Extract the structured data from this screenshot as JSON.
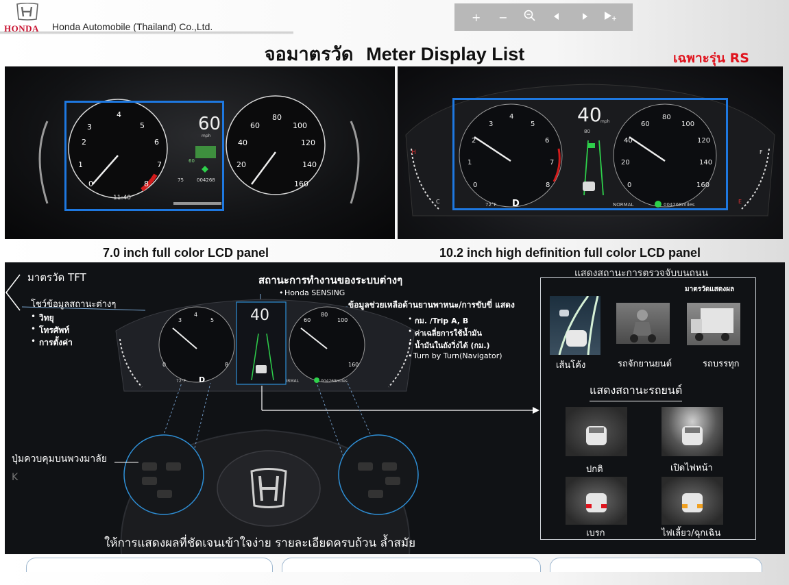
{
  "header": {
    "brand_word": "HONDA",
    "company": "Honda Automobile (Thailand) Co.,Ltd.",
    "title_th": "จอมาตรวัด",
    "title_en": "Meter Display List",
    "rs_label": "เฉพาะรุ่น RS"
  },
  "toolbar": {
    "zoom_in": "+",
    "zoom_out": "−",
    "zoom_magnifier": "⊖",
    "prev": "◆",
    "next": "◆",
    "pointer": "➤"
  },
  "panels": {
    "left_caption": "7.0 inch full color LCD panel",
    "right_caption": "10.2 inch high definition full color LCD panel",
    "left_speed": "60",
    "left_speed_unit": "mph",
    "left_clock": "11:40",
    "left_odo": "004268",
    "left_temp": "75",
    "left_cruise": "60",
    "right_speed": "40",
    "right_speed_unit": "mph",
    "right_cruise": "80",
    "right_gear": "D",
    "right_temp": "72°F",
    "right_mode": "NORMAL",
    "right_odo": "004268miles"
  },
  "lower": {
    "tft_label": "มาตรวัด TFT",
    "info_label": "โชว์ข้อมูลสถานะต่างๆ",
    "info_items": [
      "วิทยุ",
      "โทรศัพท์",
      "การตั้งค่า"
    ],
    "status_title": "สถานะการทำงานของระบบต่างๆ",
    "sensing_item": "Honda SENSING",
    "assist_title": "ข้อมูลช่วยเหลือด้านยานพาหนะ/การขับขี่ แสดง",
    "assist_items": [
      "กม. /Trip A, B",
      "ค่าเฉลี่ยการใช้น้ำมัน",
      "น้ำมันในถังวิ่งได้ (กม.)",
      "Turn by Turn(Navigator)"
    ],
    "wheel_label": "ปุ่มควบคุมบนพวงมาลัย",
    "bottom_slogan": "ให้การแสดงผลที่ชัดเจนเข้าใจง่าย รายละเอียดครบถ้วน ล้ำสมัย",
    "meter_speed": "40",
    "meter_gear": "D",
    "meter_temp": "72°F",
    "meter_mode": "NORMAL",
    "meter_odo": "004268miles"
  },
  "detect": {
    "title": "แสดงสถานะการตรวจจับบนถนน",
    "subtitle": "มาตรวัดแสดงผล",
    "items": [
      "เส้นโค้ง",
      "รถจักยานยนต์",
      "รถบรรทุก"
    ]
  },
  "car_status": {
    "title": "แสดงสถานะรถยนต์",
    "items": [
      "ปกติ",
      "เปิดไฟหน้า",
      "เบรก",
      "ไฟเลี้ยว/ฉุกเฉิน"
    ]
  },
  "colors": {
    "accent_blue": "#1e78e0",
    "honda_red": "#c8102e",
    "rs_red": "#e0141e",
    "lane_green": "#2ed04b"
  }
}
